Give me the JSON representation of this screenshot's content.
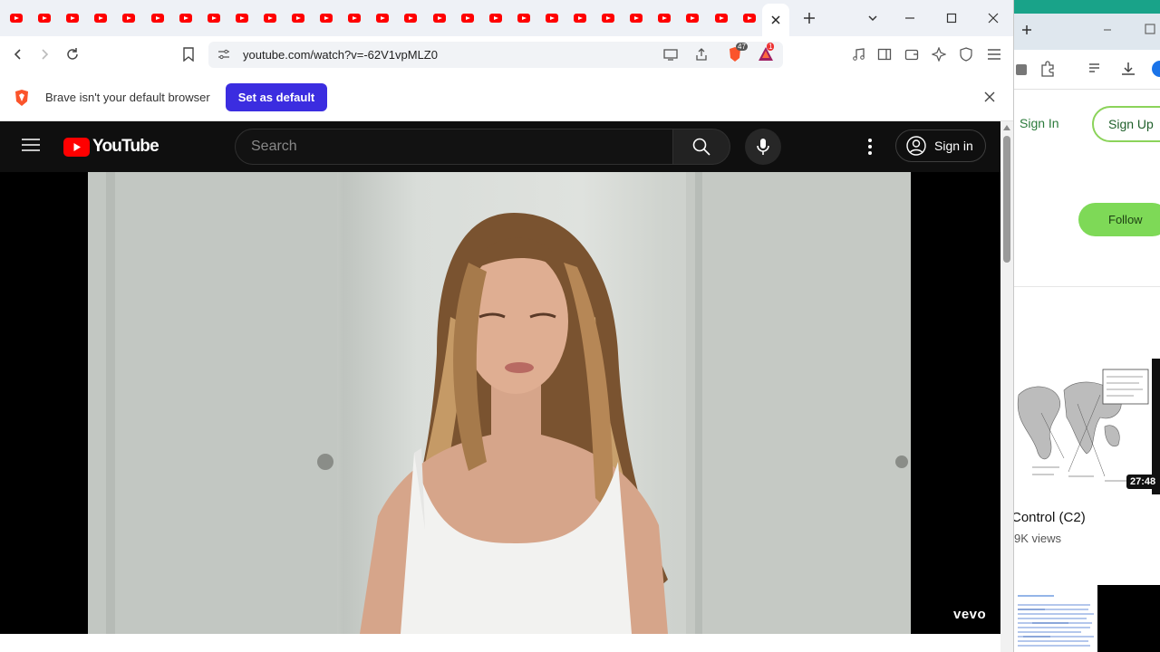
{
  "browser": {
    "address": "youtube.com/watch?v=-62V1vpMLZ0",
    "tab_count_icon": "youtube-favicon",
    "brave_badge": "47",
    "rewards_badge": "1",
    "infobar_text": "Brave isn't your default browser",
    "set_default_label": "Set as default"
  },
  "youtube": {
    "logo_text": "YouTube",
    "search_placeholder": "Search",
    "sign_in_label": "Sign in",
    "watermark": "vevo"
  },
  "right_window": {
    "sign_in": "Sign In",
    "sign_up": "Sign Up",
    "follow": "Follow",
    "video_duration": "27:48",
    "video_title": "Control (C2)",
    "views": "9K  views",
    "colors": {
      "accent": "#7ed957",
      "topbar": "#19a389"
    }
  },
  "colors": {
    "brave_button": "#3b2de0",
    "youtube_red": "#ff0000",
    "youtube_bg": "#0f0f0f"
  }
}
